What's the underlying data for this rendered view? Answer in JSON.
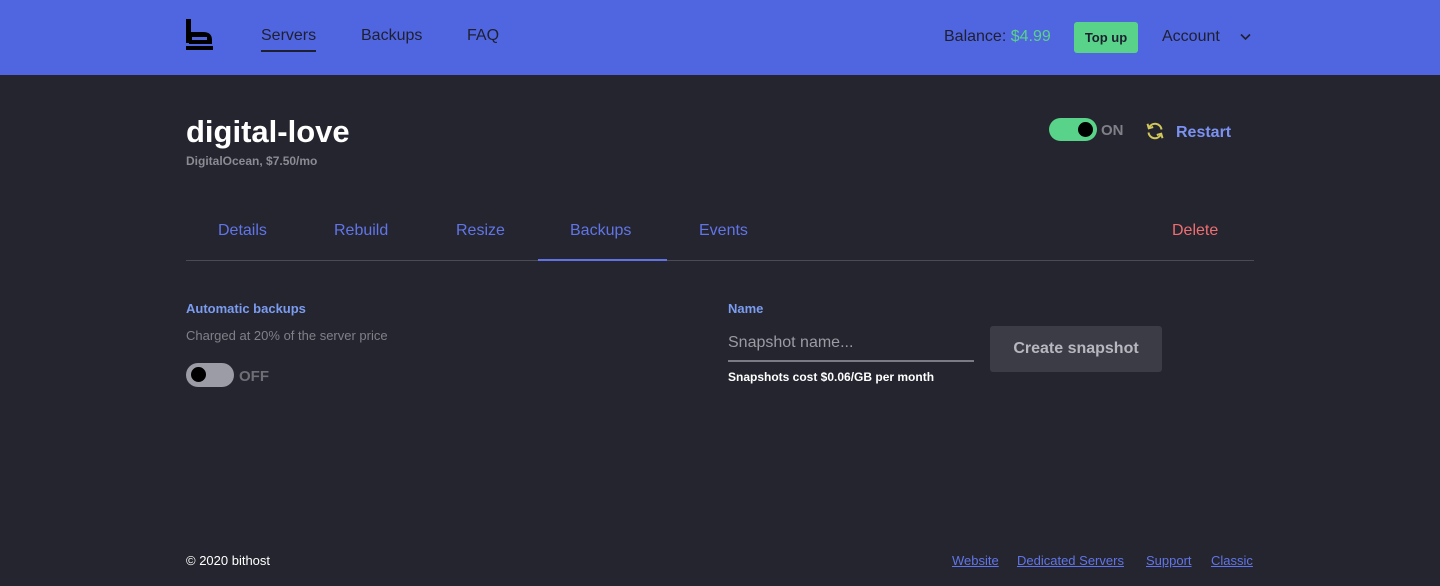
{
  "header": {
    "logo": "bithost-logo-icon",
    "nav": [
      "Servers",
      "Backups",
      "FAQ"
    ],
    "active_nav": "Servers",
    "balance_label": "Balance:",
    "balance_value": "$4.99",
    "topup_label": "Top up",
    "account_label": "Account"
  },
  "server": {
    "name": "digital-love",
    "subtitle": "DigitalOcean, $7.50/mo",
    "power_state": "ON",
    "power_on": true,
    "restart_label": "Restart"
  },
  "tabs": {
    "items": [
      "Details",
      "Rebuild",
      "Resize",
      "Backups",
      "Events"
    ],
    "active": "Backups",
    "delete_label": "Delete"
  },
  "backups": {
    "auto_title": "Automatic backups",
    "auto_desc": "Charged at 20% of the server price",
    "auto_state": "OFF",
    "auto_enabled": false
  },
  "snapshot": {
    "name_label": "Name",
    "placeholder": "Snapshot name...",
    "value": "",
    "cost_note": "Snapshots cost $0.06/GB per month",
    "create_label": "Create snapshot"
  },
  "footer": {
    "copyright": "© 2020 bithost",
    "links": [
      "Website",
      "Dedicated Servers",
      "Support",
      "Classic"
    ]
  },
  "colors": {
    "header_bg": "#5065e0",
    "page_bg": "#24252e",
    "accent": "#6175e8",
    "success": "#58d389",
    "danger": "#ef6e72"
  }
}
